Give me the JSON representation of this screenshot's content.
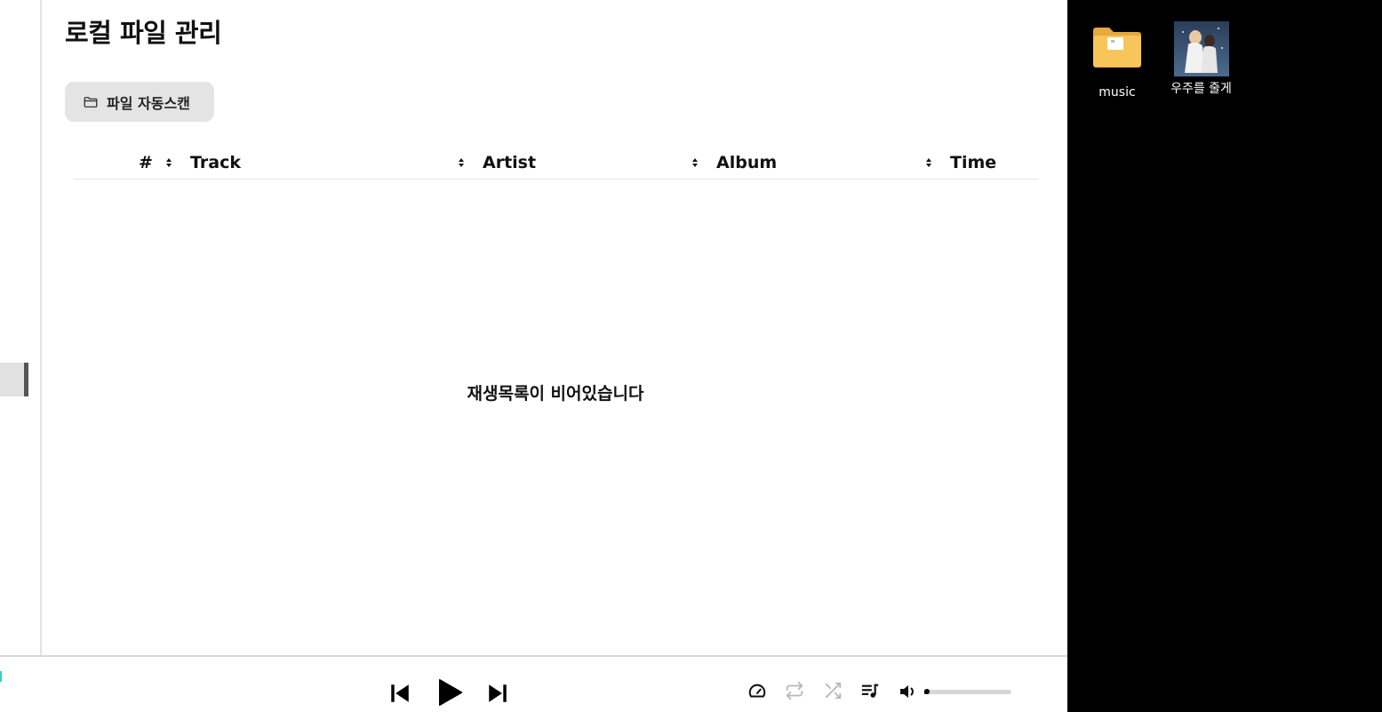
{
  "page": {
    "title": "로컬 파일 관리"
  },
  "toolbar": {
    "scan_label": "파일 자동스캔",
    "scan_icon": "folder-icon"
  },
  "table": {
    "columns": [
      {
        "key": "index",
        "label": "#"
      },
      {
        "key": "track",
        "label": "Track"
      },
      {
        "key": "artist",
        "label": "Artist"
      },
      {
        "key": "album",
        "label": "Album"
      },
      {
        "key": "time",
        "label": "Time"
      }
    ],
    "rows": [],
    "empty_message": "재생목록이 비어있습니다"
  },
  "player": {
    "controls": [
      "skip-previous-icon",
      "play-icon",
      "skip-next-icon",
      "speed-icon",
      "repeat-icon",
      "shuffle-icon",
      "queue-music-icon",
      "volume-icon"
    ],
    "volume_level": 0.02,
    "repeat_enabled": false,
    "shuffle_enabled": false
  },
  "desktop": {
    "icons": [
      {
        "label": "music",
        "icon": "folder-icon"
      },
      {
        "label": "우주를 줄게",
        "icon": "album-art-thumbnail"
      }
    ]
  },
  "colors": {
    "accent": "#2dd4c4",
    "folder": "#f8c55a",
    "button_bg": "#e4e4e4",
    "disabled_icon": "#b8b8b8",
    "desktop_bg": "#000000"
  }
}
